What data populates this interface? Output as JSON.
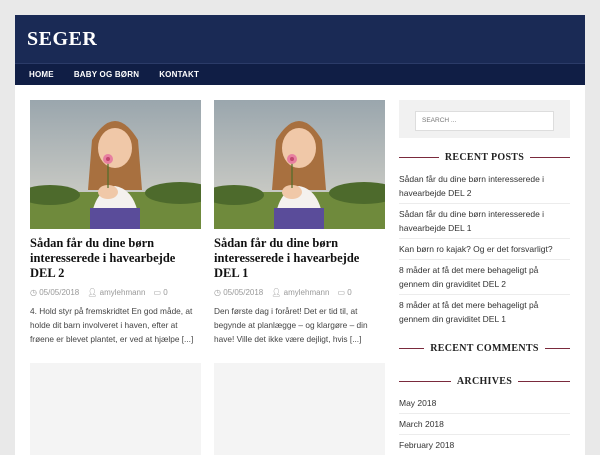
{
  "site": {
    "title": "SEGER"
  },
  "nav": {
    "items": [
      "HOME",
      "BABY OG BØRN",
      "KONTAKT"
    ]
  },
  "posts": [
    {
      "title": "Sådan får du dine børn interesserede i havearbejde DEL 2",
      "date": "05/05/2018",
      "author": "amylehmann",
      "comments": "0",
      "excerpt": "4. Hold styr på fremskridtet En god måde, at holde dit barn involveret i haven, efter at frøene er blevet plantet, er ved at hjælpe [...]"
    },
    {
      "title": "Sådan får du dine børn interesserede i havearbejde DEL 1",
      "date": "05/05/2018",
      "author": "amylehmann",
      "comments": "0",
      "excerpt": "Den første dag i foråret! Det er tid til, at begynde at planlægge – og klargøre – din have! Ville det ikke være dejligt, hvis [...]"
    }
  ],
  "sidebar": {
    "search_placeholder": "SEARCH ...",
    "recent_posts_title": "RECENT POSTS",
    "recent_posts": [
      "Sådan får du dine børn interesserede i havearbejde DEL 2",
      "Sådan får du dine børn interesserede i havearbejde DEL 1",
      "Kan børn ro kajak? Og er det forsvarligt?",
      "8 måder at få det mere behageligt på gennem din graviditet DEL 2",
      "8 måder at få det mere behageligt på gennem din graviditet DEL 1"
    ],
    "recent_comments_title": "RECENT COMMENTS",
    "archives_title": "ARCHIVES",
    "archives": [
      "May 2018",
      "March 2018",
      "February 2018"
    ]
  },
  "colors": {
    "header": "#1a2a55",
    "nav": "#101e45",
    "accent_line": "#7a2a3c"
  }
}
